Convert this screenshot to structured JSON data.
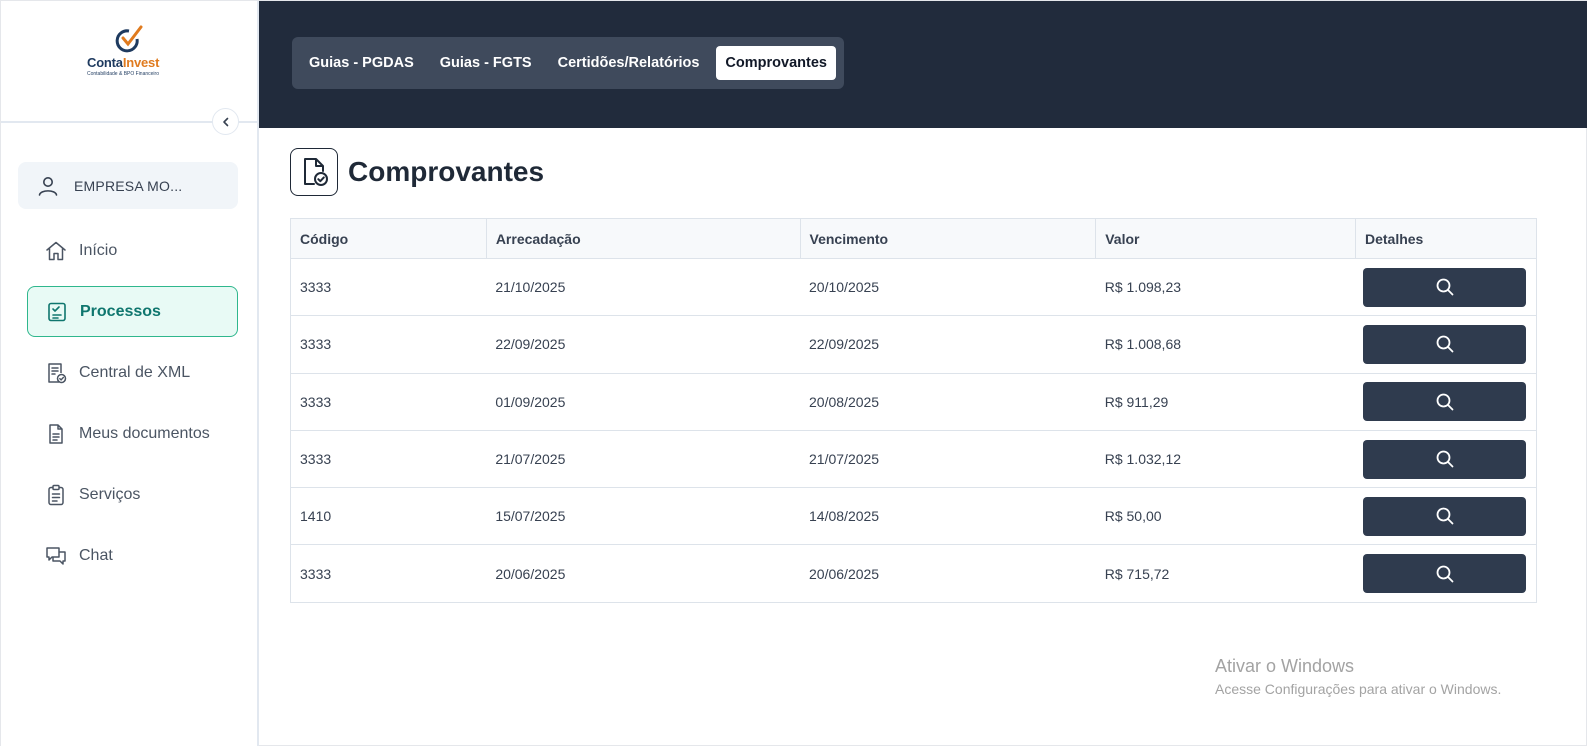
{
  "brand": {
    "name_part1": "Conta",
    "name_part2": "Invest",
    "tagline": "Contabilidade & BPO Financeiro",
    "color_primary": "#1e3a5f",
    "color_accent": "#e07b1f"
  },
  "sidebar": {
    "company_label": "EMPRESA MO...",
    "company_icon": "user-icon",
    "collapse_icon": "chevron-left-icon",
    "items": [
      {
        "label": "Início",
        "icon": "home-icon",
        "active": false
      },
      {
        "label": "Processos",
        "icon": "checklist-icon",
        "active": true
      },
      {
        "label": "Central de XML",
        "icon": "xml-document-icon",
        "active": false
      },
      {
        "label": "Meus documentos",
        "icon": "document-icon",
        "active": false
      },
      {
        "label": "Serviços",
        "icon": "clipboard-icon",
        "active": false
      },
      {
        "label": "Chat",
        "icon": "chat-icon",
        "active": false
      }
    ]
  },
  "header": {
    "tabs": [
      {
        "label": "Guias - PGDAS",
        "active": false
      },
      {
        "label": "Guias - FGTS",
        "active": false
      },
      {
        "label": "Certidões/Relatórios",
        "active": false
      },
      {
        "label": "Comprovantes",
        "active": true
      }
    ]
  },
  "main": {
    "title": "Comprovantes",
    "title_icon": "file-check-icon",
    "table": {
      "columns": [
        "Código",
        "Arrecadação",
        "Vencimento",
        "Valor",
        "Detalhes"
      ],
      "rows": [
        {
          "codigo": "3333",
          "arrecadacao": "21/10/2025",
          "vencimento": "20/10/2025",
          "valor": "R$ 1.098,23"
        },
        {
          "codigo": "3333",
          "arrecadacao": "22/09/2025",
          "vencimento": "22/09/2025",
          "valor": "R$ 1.008,68"
        },
        {
          "codigo": "3333",
          "arrecadacao": "01/09/2025",
          "vencimento": "20/08/2025",
          "valor": "R$ 911,29"
        },
        {
          "codigo": "3333",
          "arrecadacao": "21/07/2025",
          "vencimento": "21/07/2025",
          "valor": "R$ 1.032,12"
        },
        {
          "codigo": "1410",
          "arrecadacao": "15/07/2025",
          "vencimento": "14/08/2025",
          "valor": "R$ 50,00"
        },
        {
          "codigo": "3333",
          "arrecadacao": "20/06/2025",
          "vencimento": "20/06/2025",
          "valor": "R$ 715,72"
        }
      ],
      "detail_icon": "search-icon"
    }
  },
  "watermark": {
    "line1": "Ativar o Windows",
    "line2": "Acesse Configurações para ativar o Windows."
  },
  "colors": {
    "header_bg": "#212b3c",
    "tab_group_bg": "#3f4a5c",
    "button_bg": "#2f3b4e",
    "active_nav_bg": "#e8faf5",
    "active_nav_border": "#2fb78d",
    "active_nav_text": "#0f766e"
  }
}
